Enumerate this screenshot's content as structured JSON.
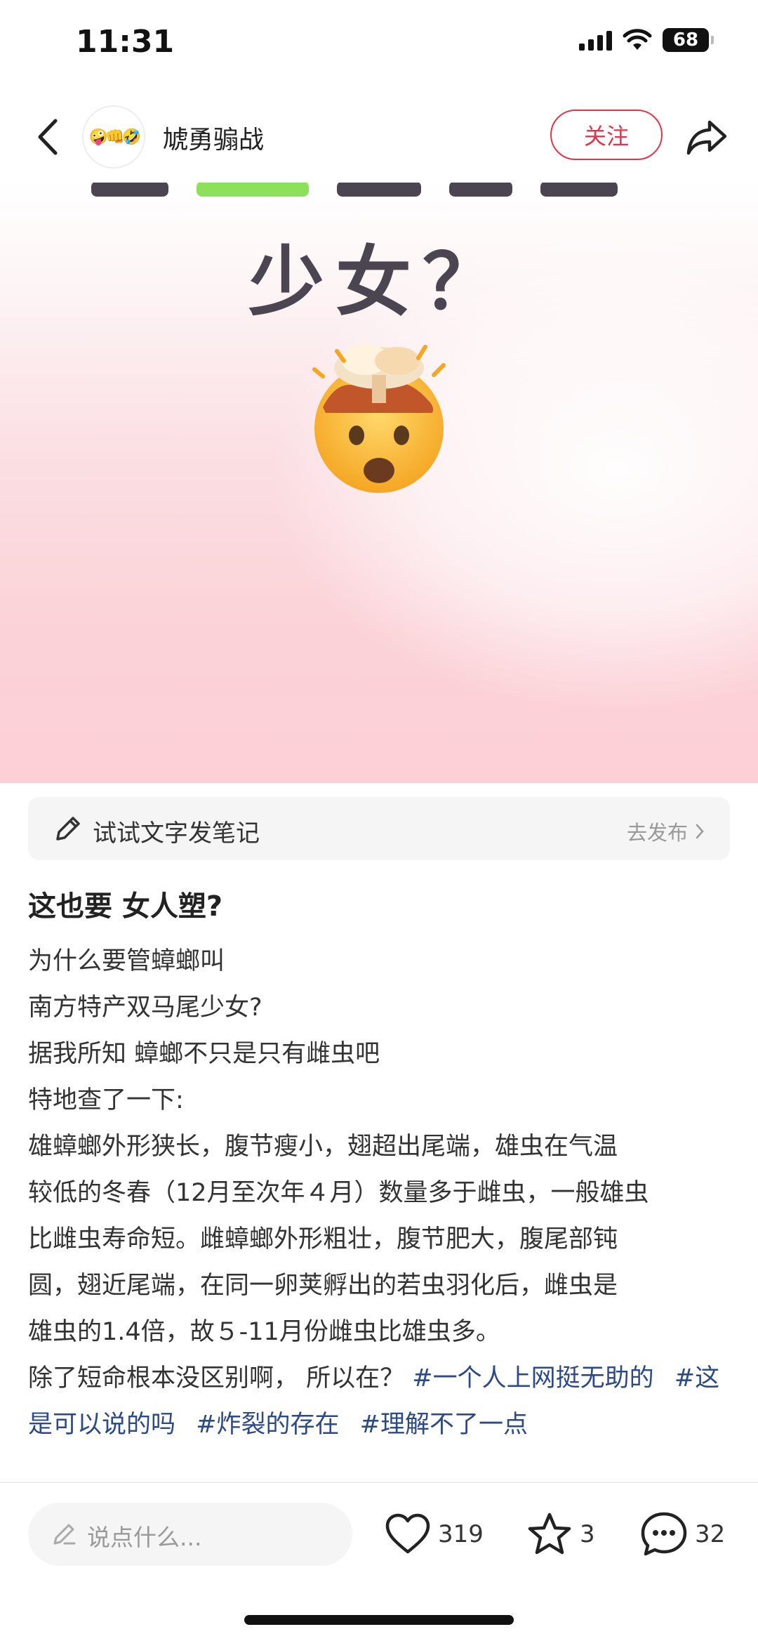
{
  "status_bar": {
    "time": "11:31",
    "battery": "68"
  },
  "header": {
    "avatar_emoji": "🤪👊🤣",
    "author_name": "虓勇骟战",
    "follow_label": "关注"
  },
  "image": {
    "caption": "少女？",
    "emoji": "🤯"
  },
  "write_note": {
    "label": "试试文字发笔记",
    "action": "去发布"
  },
  "post": {
    "title": "这也要 女人塑?",
    "lines": [
      "为什么要管蟑螂叫",
      "南方特产双马尾少女?",
      "据我所知 蟑螂不只是只有雌虫吧",
      "特地查了一下:",
      "雄蟑螂外形狭长，腹节瘦小，翅超出尾端，雄虫在气温",
      "较低的冬春（12月至次年４月）数量多于雌虫，一般雄虫",
      "比雌虫寿命短。雌蟑螂外形粗壮，腹节肥大，腹尾部钝",
      "圆，翅近尾端，在同一卵荚孵出的若虫羽化后，雌虫是",
      "雄虫的1.4倍，故５-11月份雌虫比雄虫多。"
    ],
    "last_line_text": "除了短命根本没区别啊， 所以在？",
    "tags": [
      "#一个人上网挺无助的",
      "#这是可以说的吗",
      "#炸裂的存在",
      "#理解不了一点"
    ]
  },
  "bottom_bar": {
    "comment_placeholder": "说点什么...",
    "likes": "319",
    "favorites": "3",
    "comments": "32"
  },
  "colors": {
    "accent": "#e6334b",
    "tag": "#2c4a87"
  }
}
